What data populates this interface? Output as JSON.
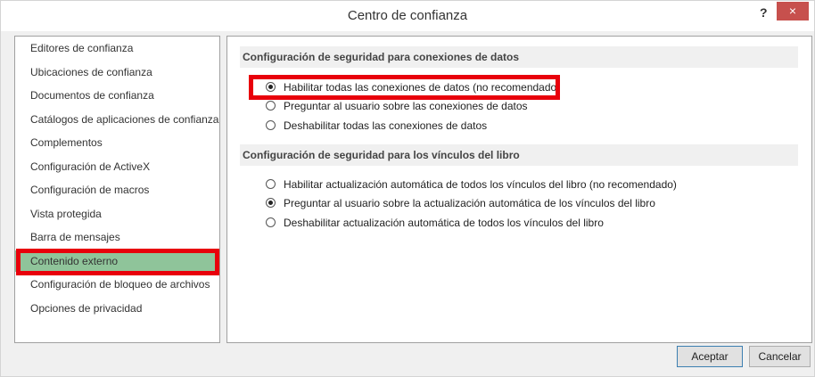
{
  "window": {
    "title": "Centro de confianza",
    "help": "?",
    "close": "×"
  },
  "sidebar": {
    "items": [
      {
        "label": "Editores de confianza"
      },
      {
        "label": "Ubicaciones de confianza"
      },
      {
        "label": "Documentos de confianza"
      },
      {
        "label": "Catálogos de aplicaciones de confianza"
      },
      {
        "label": "Complementos"
      },
      {
        "label": "Configuración de ActiveX"
      },
      {
        "label": "Configuración de macros"
      },
      {
        "label": "Vista protegida"
      },
      {
        "label": "Barra de mensajes"
      },
      {
        "label": "Contenido externo",
        "selected": true
      },
      {
        "label": "Configuración de bloqueo de archivos"
      },
      {
        "label": "Opciones de privacidad"
      }
    ]
  },
  "sections": {
    "data_connections": {
      "title": "Configuración de seguridad para conexiones de datos",
      "options": [
        {
          "label": "Habilitar todas las conexiones de datos (no recomendado)",
          "selected": true
        },
        {
          "label": "Preguntar al usuario sobre las conexiones de datos",
          "selected": false
        },
        {
          "label": "Deshabilitar todas las conexiones de datos",
          "selected": false
        }
      ]
    },
    "workbook_links": {
      "title": "Configuración de seguridad para los vínculos del libro",
      "options": [
        {
          "label": "Habilitar actualización automática de todos los vínculos del libro (no recomendado)",
          "selected": false
        },
        {
          "label": "Preguntar al usuario sobre la actualización automática de los vínculos del libro",
          "selected": true
        },
        {
          "label": "Deshabilitar actualización automática de todos los vínculos del libro",
          "selected": false
        }
      ]
    }
  },
  "buttons": {
    "ok": "Aceptar",
    "cancel": "Cancelar"
  },
  "colors": {
    "highlight": "#e8000b",
    "selected_item": "#8fc49a",
    "close_button": "#c7504d"
  }
}
